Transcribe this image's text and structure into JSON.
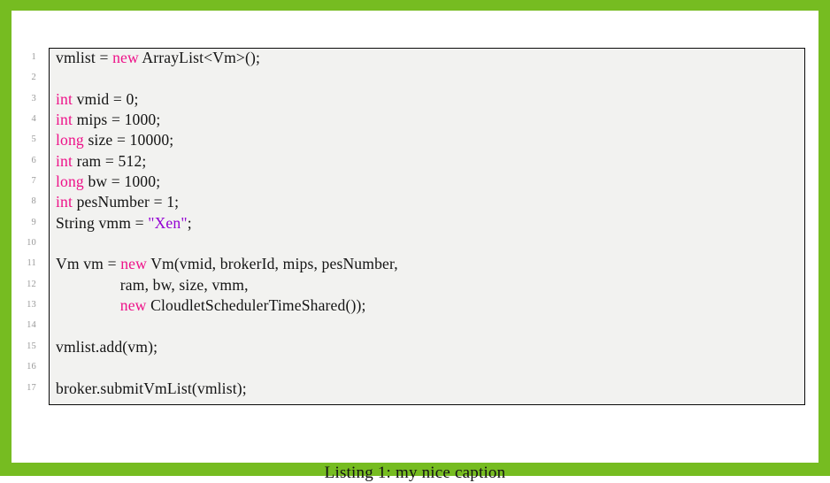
{
  "page": {
    "border_color": "#76bc21",
    "background_color": "#ffffff"
  },
  "listing": {
    "background_color": "#f2f2f0",
    "border_color": "#0a0a0a",
    "keyword_color": "#ee1289",
    "string_color": "#9400d3",
    "text_color": "#141414",
    "lineno_color": "#9a9a9a",
    "language": "Java",
    "lines": [
      {
        "number": "1",
        "tokens": [
          {
            "t": "vmlist = ",
            "c": "plain"
          },
          {
            "t": "new",
            "c": "kw"
          },
          {
            "t": " ArrayList<Vm>();",
            "c": "plain"
          }
        ]
      },
      {
        "number": "2",
        "tokens": []
      },
      {
        "number": "3",
        "tokens": [
          {
            "t": "int",
            "c": "kw"
          },
          {
            "t": " vmid = 0;",
            "c": "plain"
          }
        ]
      },
      {
        "number": "4",
        "tokens": [
          {
            "t": "int",
            "c": "kw"
          },
          {
            "t": " mips = 1000;",
            "c": "plain"
          }
        ]
      },
      {
        "number": "5",
        "tokens": [
          {
            "t": "long",
            "c": "kw"
          },
          {
            "t": " size = 10000;",
            "c": "plain"
          }
        ]
      },
      {
        "number": "6",
        "tokens": [
          {
            "t": "int",
            "c": "kw"
          },
          {
            "t": " ram = 512;",
            "c": "plain"
          }
        ]
      },
      {
        "number": "7",
        "tokens": [
          {
            "t": "long",
            "c": "kw"
          },
          {
            "t": " bw = 1000;",
            "c": "plain"
          }
        ]
      },
      {
        "number": "8",
        "tokens": [
          {
            "t": "int",
            "c": "kw"
          },
          {
            "t": " pesNumber = 1;",
            "c": "plain"
          }
        ]
      },
      {
        "number": "9",
        "tokens": [
          {
            "t": "String vmm = ",
            "c": "plain"
          },
          {
            "t": "\"Xen\"",
            "c": "str"
          },
          {
            "t": ";",
            "c": "plain"
          }
        ]
      },
      {
        "number": "10",
        "tokens": []
      },
      {
        "number": "11",
        "tokens": [
          {
            "t": "Vm vm = ",
            "c": "plain"
          },
          {
            "t": "new",
            "c": "kw"
          },
          {
            "t": " Vm(vmid, brokerId, mips, pesNumber,",
            "c": "plain"
          }
        ]
      },
      {
        "number": "12",
        "tokens": [
          {
            "t": "                ram, bw, size, vmm,",
            "c": "plain"
          }
        ]
      },
      {
        "number": "13",
        "tokens": [
          {
            "t": "                ",
            "c": "plain"
          },
          {
            "t": "new",
            "c": "kw"
          },
          {
            "t": " CloudletSchedulerTimeShared());",
            "c": "plain"
          }
        ]
      },
      {
        "number": "14",
        "tokens": []
      },
      {
        "number": "15",
        "tokens": [
          {
            "t": "vmlist.add(vm);",
            "c": "plain"
          }
        ]
      },
      {
        "number": "16",
        "tokens": []
      },
      {
        "number": "17",
        "tokens": [
          {
            "t": "broker.submitVmList(vmlist);",
            "c": "plain"
          }
        ]
      }
    ]
  },
  "caption": {
    "label": "Listing 1:",
    "text": "my nice caption",
    "full": "Listing 1: my nice caption"
  }
}
